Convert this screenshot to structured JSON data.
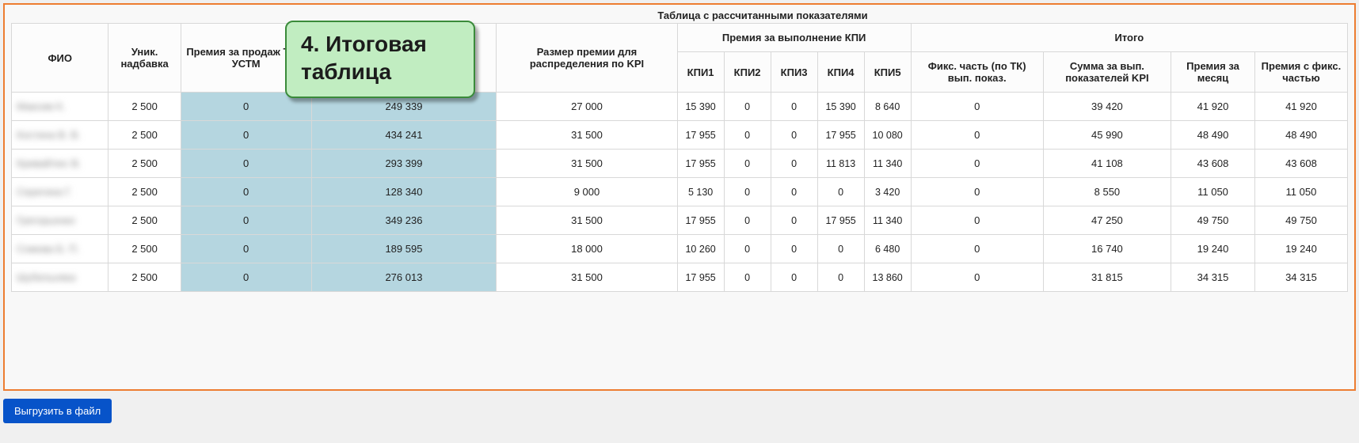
{
  "title": "Таблица с рассчитанными показателями",
  "callout": "4. Итоговая таблица",
  "export_label": "Выгрузить в файл",
  "headers": {
    "fio": "ФИО",
    "unik": "Уник. надбавка",
    "prem_td": "Премия за продаж ТД и УСТМ",
    "col4": "",
    "razmer": "Размер премии для распределения по KPI",
    "group_kpi": "Премия за выполнение КПИ",
    "kpi1": "КПИ1",
    "kpi2": "КПИ2",
    "kpi3": "КПИ3",
    "kpi4": "КПИ4",
    "kpi5": "КПИ5",
    "group_itogo": "Итого",
    "fiks": "Фикс. часть (по ТК) вып. показ.",
    "sum_kpi": "Сумма за вып. показателей KPI",
    "prem_mon": "Премия за месяц",
    "prem_fix": "Премия с фикс. частью"
  },
  "rows": [
    {
      "name": "Максим К.",
      "unik": "2 500",
      "prem_td": "0",
      "col4": "249 339",
      "razmer": "27 000",
      "kpi1": "15 390",
      "kpi2": "0",
      "kpi3": "0",
      "kpi4": "15 390",
      "kpi5": "8 640",
      "fiks": "0",
      "sum_kpi": "39 420",
      "prem_mon": "41 920",
      "prem_fix": "41 920"
    },
    {
      "name": "Костина В. В.",
      "unik": "2 500",
      "prem_td": "0",
      "col4": "434 241",
      "razmer": "31 500",
      "kpi1": "17 955",
      "kpi2": "0",
      "kpi3": "0",
      "kpi4": "17 955",
      "kpi5": "10 080",
      "fiks": "0",
      "sum_kpi": "45 990",
      "prem_mon": "48 490",
      "prem_fix": "48 490"
    },
    {
      "name": "Кривайтюс В.",
      "unik": "2 500",
      "prem_td": "0",
      "col4": "293 399",
      "razmer": "31 500",
      "kpi1": "17 955",
      "kpi2": "0",
      "kpi3": "0",
      "kpi4": "11 813",
      "kpi5": "11 340",
      "fiks": "0",
      "sum_kpi": "41 108",
      "prem_mon": "43 608",
      "prem_fix": "43 608"
    },
    {
      "name": "Серегина Г.",
      "unik": "2 500",
      "prem_td": "0",
      "col4": "128 340",
      "razmer": "9 000",
      "kpi1": "5 130",
      "kpi2": "0",
      "kpi3": "0",
      "kpi4": "0",
      "kpi5": "3 420",
      "fiks": "0",
      "sum_kpi": "8 550",
      "prem_mon": "11 050",
      "prem_fix": "11 050"
    },
    {
      "name": "Грегорьенко",
      "unik": "2 500",
      "prem_td": "0",
      "col4": "349 236",
      "razmer": "31 500",
      "kpi1": "17 955",
      "kpi2": "0",
      "kpi3": "0",
      "kpi4": "17 955",
      "kpi5": "11 340",
      "fiks": "0",
      "sum_kpi": "47 250",
      "prem_mon": "49 750",
      "prem_fix": "49 750"
    },
    {
      "name": "Сомова Б. П.",
      "unik": "2 500",
      "prem_td": "0",
      "col4": "189 595",
      "razmer": "18 000",
      "kpi1": "10 260",
      "kpi2": "0",
      "kpi3": "0",
      "kpi4": "0",
      "kpi5": "6 480",
      "fiks": "0",
      "sum_kpi": "16 740",
      "prem_mon": "19 240",
      "prem_fix": "19 240"
    },
    {
      "name": "Шубельняка",
      "unik": "2 500",
      "prem_td": "0",
      "col4": "276 013",
      "razmer": "31 500",
      "kpi1": "17 955",
      "kpi2": "0",
      "kpi3": "0",
      "kpi4": "0",
      "kpi5": "13 860",
      "fiks": "0",
      "sum_kpi": "31 815",
      "prem_mon": "34 315",
      "prem_fix": "34 315"
    }
  ]
}
